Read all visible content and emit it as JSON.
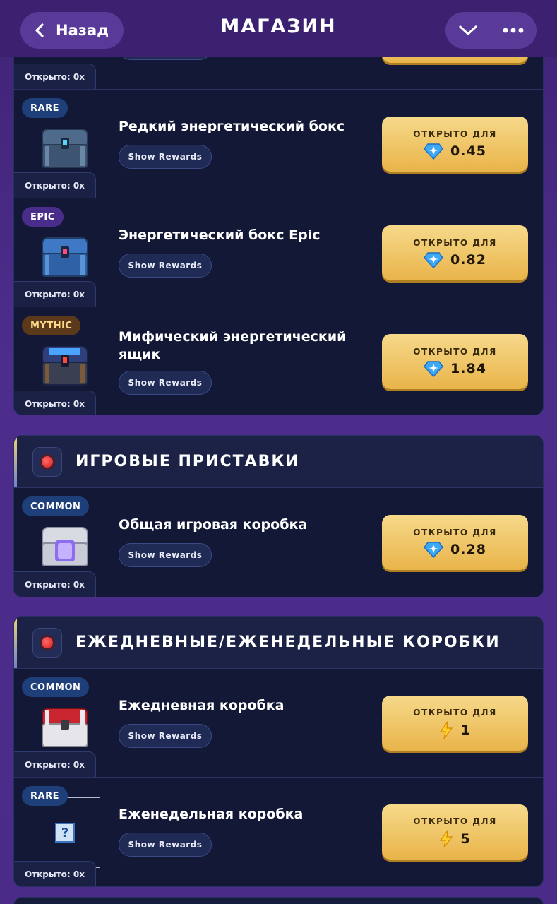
{
  "header": {
    "back_label": "Назад",
    "title": "МАГАЗИН"
  },
  "top_panel": {
    "partial_row": {
      "opened": "Открыто: 0x"
    },
    "rows": [
      {
        "badge": "RARE",
        "rarity": "rare",
        "name": "Редкий энергетический бокс",
        "show": "Show Rewards",
        "buy_caption": "ОТКРЫТО ДЛЯ",
        "currency": "gem",
        "price": "0.45",
        "opened": "Открыто: 0x"
      },
      {
        "badge": "EPIC",
        "rarity": "epic",
        "name": "Энергетический бокс Epic",
        "show": "Show Rewards",
        "buy_caption": "ОТКРЫТО ДЛЯ",
        "currency": "gem",
        "price": "0.82",
        "opened": "Открыто: 0x"
      },
      {
        "badge": "MYTHIC",
        "rarity": "mythic",
        "name": "Мифический энергетический ящик",
        "show": "Show Rewards",
        "buy_caption": "ОТКРЫТО ДЛЯ",
        "currency": "gem",
        "price": "1.84",
        "opened": "Открыто: 0x"
      }
    ]
  },
  "consoles": {
    "title": "ИГРОВЫЕ ПРИСТАВКИ",
    "rows": [
      {
        "badge": "COMMON",
        "rarity": "common",
        "name": "Общая игровая коробка",
        "show": "Show Rewards",
        "buy_caption": "ОТКРЫТО ДЛЯ",
        "currency": "gem",
        "price": "0.28",
        "opened": "Открыто: 0x"
      }
    ]
  },
  "daily": {
    "title": "ЕЖЕДНЕВНЫЕ/ЕЖЕНЕДЕЛЬНЫЕ КОРОБКИ",
    "rows": [
      {
        "badge": "COMMON",
        "rarity": "common",
        "name": "Ежедневная коробка",
        "show": "Show Rewards",
        "buy_caption": "ОТКРЫТО ДЛЯ",
        "currency": "bolt",
        "price": "1",
        "opened": "Открыто: 0x"
      },
      {
        "badge": "RARE",
        "rarity": "rare",
        "name": "Еженедельная коробка",
        "show": "Show Rewards",
        "buy_caption": "ОТКРЫТО ДЛЯ",
        "currency": "bolt",
        "price": "5",
        "opened": "Открыто: 0x"
      }
    ]
  },
  "colors": {
    "gold_button": "#e9b44a",
    "panel_bg": "#161c3b",
    "page_bg": "#4a2a86"
  }
}
